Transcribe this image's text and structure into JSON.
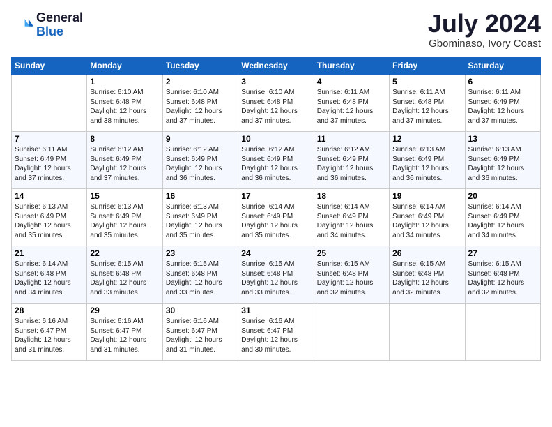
{
  "header": {
    "logo_general": "General",
    "logo_blue": "Blue",
    "month_title": "July 2024",
    "location": "Gbominaso, Ivory Coast"
  },
  "days_of_week": [
    "Sunday",
    "Monday",
    "Tuesday",
    "Wednesday",
    "Thursday",
    "Friday",
    "Saturday"
  ],
  "weeks": [
    [
      {
        "day": "",
        "info": ""
      },
      {
        "day": "1",
        "info": "Sunrise: 6:10 AM\nSunset: 6:48 PM\nDaylight: 12 hours\nand 38 minutes."
      },
      {
        "day": "2",
        "info": "Sunrise: 6:10 AM\nSunset: 6:48 PM\nDaylight: 12 hours\nand 37 minutes."
      },
      {
        "day": "3",
        "info": "Sunrise: 6:10 AM\nSunset: 6:48 PM\nDaylight: 12 hours\nand 37 minutes."
      },
      {
        "day": "4",
        "info": "Sunrise: 6:11 AM\nSunset: 6:48 PM\nDaylight: 12 hours\nand 37 minutes."
      },
      {
        "day": "5",
        "info": "Sunrise: 6:11 AM\nSunset: 6:48 PM\nDaylight: 12 hours\nand 37 minutes."
      },
      {
        "day": "6",
        "info": "Sunrise: 6:11 AM\nSunset: 6:49 PM\nDaylight: 12 hours\nand 37 minutes."
      }
    ],
    [
      {
        "day": "7",
        "info": "Sunrise: 6:11 AM\nSunset: 6:49 PM\nDaylight: 12 hours\nand 37 minutes."
      },
      {
        "day": "8",
        "info": "Sunrise: 6:12 AM\nSunset: 6:49 PM\nDaylight: 12 hours\nand 37 minutes."
      },
      {
        "day": "9",
        "info": "Sunrise: 6:12 AM\nSunset: 6:49 PM\nDaylight: 12 hours\nand 36 minutes."
      },
      {
        "day": "10",
        "info": "Sunrise: 6:12 AM\nSunset: 6:49 PM\nDaylight: 12 hours\nand 36 minutes."
      },
      {
        "day": "11",
        "info": "Sunrise: 6:12 AM\nSunset: 6:49 PM\nDaylight: 12 hours\nand 36 minutes."
      },
      {
        "day": "12",
        "info": "Sunrise: 6:13 AM\nSunset: 6:49 PM\nDaylight: 12 hours\nand 36 minutes."
      },
      {
        "day": "13",
        "info": "Sunrise: 6:13 AM\nSunset: 6:49 PM\nDaylight: 12 hours\nand 36 minutes."
      }
    ],
    [
      {
        "day": "14",
        "info": "Sunrise: 6:13 AM\nSunset: 6:49 PM\nDaylight: 12 hours\nand 35 minutes."
      },
      {
        "day": "15",
        "info": "Sunrise: 6:13 AM\nSunset: 6:49 PM\nDaylight: 12 hours\nand 35 minutes."
      },
      {
        "day": "16",
        "info": "Sunrise: 6:13 AM\nSunset: 6:49 PM\nDaylight: 12 hours\nand 35 minutes."
      },
      {
        "day": "17",
        "info": "Sunrise: 6:14 AM\nSunset: 6:49 PM\nDaylight: 12 hours\nand 35 minutes."
      },
      {
        "day": "18",
        "info": "Sunrise: 6:14 AM\nSunset: 6:49 PM\nDaylight: 12 hours\nand 34 minutes."
      },
      {
        "day": "19",
        "info": "Sunrise: 6:14 AM\nSunset: 6:49 PM\nDaylight: 12 hours\nand 34 minutes."
      },
      {
        "day": "20",
        "info": "Sunrise: 6:14 AM\nSunset: 6:49 PM\nDaylight: 12 hours\nand 34 minutes."
      }
    ],
    [
      {
        "day": "21",
        "info": "Sunrise: 6:14 AM\nSunset: 6:48 PM\nDaylight: 12 hours\nand 34 minutes."
      },
      {
        "day": "22",
        "info": "Sunrise: 6:15 AM\nSunset: 6:48 PM\nDaylight: 12 hours\nand 33 minutes."
      },
      {
        "day": "23",
        "info": "Sunrise: 6:15 AM\nSunset: 6:48 PM\nDaylight: 12 hours\nand 33 minutes."
      },
      {
        "day": "24",
        "info": "Sunrise: 6:15 AM\nSunset: 6:48 PM\nDaylight: 12 hours\nand 33 minutes."
      },
      {
        "day": "25",
        "info": "Sunrise: 6:15 AM\nSunset: 6:48 PM\nDaylight: 12 hours\nand 32 minutes."
      },
      {
        "day": "26",
        "info": "Sunrise: 6:15 AM\nSunset: 6:48 PM\nDaylight: 12 hours\nand 32 minutes."
      },
      {
        "day": "27",
        "info": "Sunrise: 6:15 AM\nSunset: 6:48 PM\nDaylight: 12 hours\nand 32 minutes."
      }
    ],
    [
      {
        "day": "28",
        "info": "Sunrise: 6:16 AM\nSunset: 6:47 PM\nDaylight: 12 hours\nand 31 minutes."
      },
      {
        "day": "29",
        "info": "Sunrise: 6:16 AM\nSunset: 6:47 PM\nDaylight: 12 hours\nand 31 minutes."
      },
      {
        "day": "30",
        "info": "Sunrise: 6:16 AM\nSunset: 6:47 PM\nDaylight: 12 hours\nand 31 minutes."
      },
      {
        "day": "31",
        "info": "Sunrise: 6:16 AM\nSunset: 6:47 PM\nDaylight: 12 hours\nand 30 minutes."
      },
      {
        "day": "",
        "info": ""
      },
      {
        "day": "",
        "info": ""
      },
      {
        "day": "",
        "info": ""
      }
    ]
  ]
}
